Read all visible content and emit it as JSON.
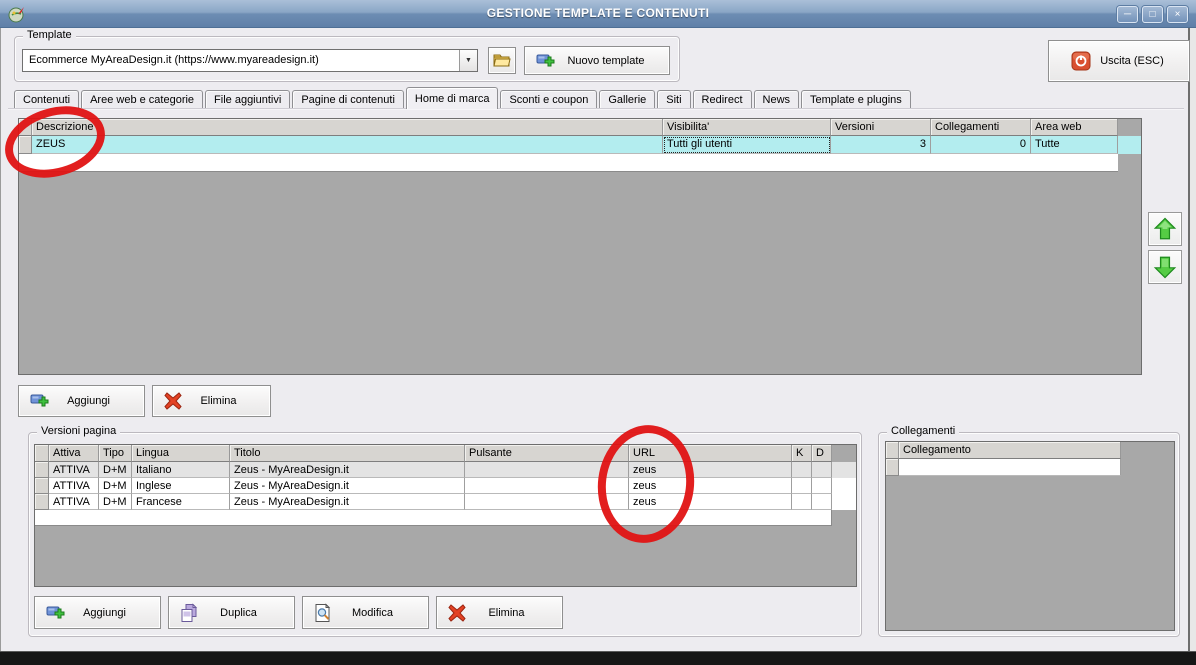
{
  "window": {
    "title": "GESTIONE TEMPLATE E CONTENUTI",
    "minimize_glyph": "─",
    "maximize_glyph": "□",
    "close_glyph": "×"
  },
  "template": {
    "group_label": "Template",
    "combo_value": "Ecommerce MyAreaDesign.it (https://www.myareadesign.it)",
    "new_template_label": "Nuovo template"
  },
  "exit": {
    "label": "Uscita (ESC)"
  },
  "tabs": [
    "Contenuti",
    "Aree web e categorie",
    "File aggiuntivi",
    "Pagine di contenuti",
    "Home di marca",
    "Sconti e coupon",
    "Gallerie",
    "Siti",
    "Redirect",
    "News",
    "Template e plugins"
  ],
  "active_tab": "Home di marca",
  "main_grid": {
    "headers": {
      "descrizione": "Descrizione",
      "visibilita": "Visibilita'",
      "versioni": "Versioni",
      "collegamenti": "Collegamenti",
      "area_web": "Area web"
    },
    "row": {
      "descrizione": "ZEUS",
      "visibilita": "Tutti gli utenti",
      "versioni": "3",
      "collegamenti": "0",
      "area_web": "Tutte"
    }
  },
  "main_actions": {
    "add": "Aggiungi",
    "remove": "Elimina"
  },
  "versions": {
    "group_label": "Versioni pagina",
    "headers": {
      "attiva": "Attiva",
      "tipo": "Tipo",
      "lingua": "Lingua",
      "titolo": "Titolo",
      "pulsante": "Pulsante",
      "url": "URL",
      "k": "K",
      "d": "D"
    },
    "rows": [
      {
        "attiva": "ATTIVA",
        "tipo": "D+M",
        "lingua": "Italiano",
        "titolo": "Zeus - MyAreaDesign.it",
        "pulsante": "",
        "url": "zeus",
        "k": "",
        "d": ""
      },
      {
        "attiva": "ATTIVA",
        "tipo": "D+M",
        "lingua": "Inglese",
        "titolo": "Zeus - MyAreaDesign.it",
        "pulsante": "",
        "url": "zeus",
        "k": "",
        "d": ""
      },
      {
        "attiva": "ATTIVA",
        "tipo": "D+M",
        "lingua": "Francese",
        "titolo": "Zeus - MyAreaDesign.it",
        "pulsante": "",
        "url": "zeus",
        "k": "",
        "d": ""
      }
    ],
    "buttons": {
      "add": "Aggiungi",
      "duplicate": "Duplica",
      "edit": "Modifica",
      "remove": "Elimina"
    }
  },
  "links": {
    "group_label": "Collegamenti",
    "header": "Collegamento"
  },
  "colors": {
    "annotation_red": "#e01313",
    "selected_row_cyan": "#b3edef",
    "titlebar_top": "#aabfd8",
    "titlebar_bottom": "#5f80a8"
  }
}
